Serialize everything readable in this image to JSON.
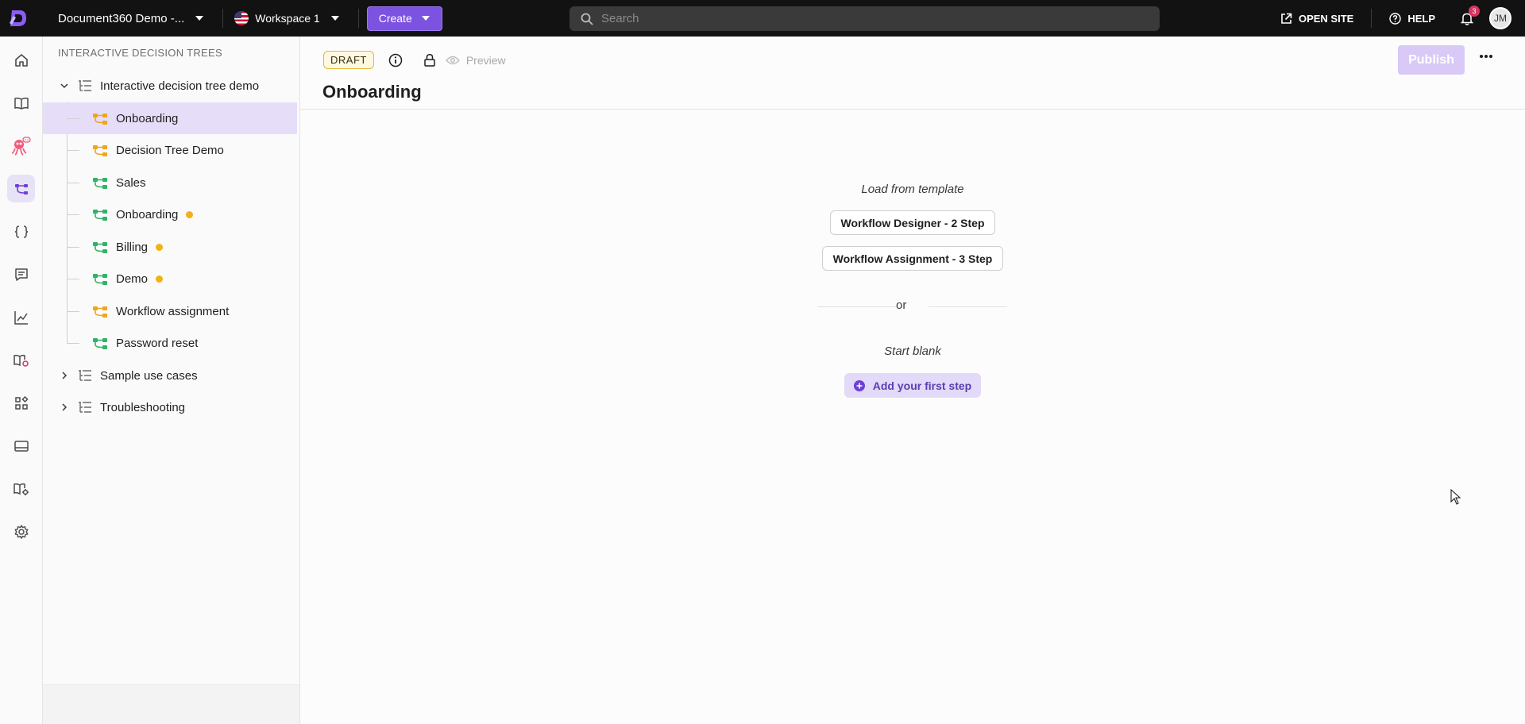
{
  "topbar": {
    "project_name": "Document360 Demo -...",
    "workspace": "Workspace 1",
    "create_label": "Create",
    "search_placeholder": "Search",
    "open_site_label": "OPEN SITE",
    "help_label": "HELP",
    "notification_count": "3",
    "avatar_initials": "JM"
  },
  "rail": {
    "items": [
      "home-icon",
      "book-icon",
      "bot-icon",
      "decision-tree-icon",
      "curly-braces-icon",
      "comment-icon",
      "analytics-icon",
      "knowledge-base-icon",
      "widgets-icon",
      "layout-icon",
      "book-settings-icon",
      "settings-icon"
    ],
    "active": "decision-tree-icon"
  },
  "tree": {
    "header": "INTERACTIVE DECISION TREES",
    "categories": [
      {
        "label": "Interactive decision tree demo",
        "expanded": true,
        "children": [
          {
            "label": "Onboarding",
            "color": "#f2a51a",
            "selected": true,
            "dot": false
          },
          {
            "label": "Decision Tree Demo",
            "color": "#f2a51a",
            "selected": false,
            "dot": false
          },
          {
            "label": "Sales",
            "color": "#2fb36a",
            "selected": false,
            "dot": false
          },
          {
            "label": "Onboarding",
            "color": "#2fb36a",
            "selected": false,
            "dot": true
          },
          {
            "label": "Billing",
            "color": "#2fb36a",
            "selected": false,
            "dot": true
          },
          {
            "label": "Demo",
            "color": "#2fb36a",
            "selected": false,
            "dot": true
          },
          {
            "label": "Workflow assignment",
            "color": "#f2a51a",
            "selected": false,
            "dot": false
          },
          {
            "label": "Password reset",
            "color": "#2fb36a",
            "selected": false,
            "dot": false
          }
        ]
      },
      {
        "label": "Sample use cases",
        "expanded": false
      },
      {
        "label": "Troubleshooting",
        "expanded": false
      }
    ]
  },
  "main": {
    "status_badge": "DRAFT",
    "preview_label": "Preview",
    "publish_label": "Publish",
    "title": "Onboarding",
    "load_template_label": "Load from template",
    "templates": [
      "Workflow Designer - 2 Step",
      "Workflow Assignment - 3 Step"
    ],
    "or_label": "or",
    "start_blank_label": "Start blank",
    "add_step_label": "Add your first step"
  },
  "colors": {
    "accent": "#7c52e0",
    "topbar_bg": "#121212",
    "selected_row": "#e6def9",
    "draft_border": "#e0b93a",
    "status_dot": "#f2b213"
  }
}
